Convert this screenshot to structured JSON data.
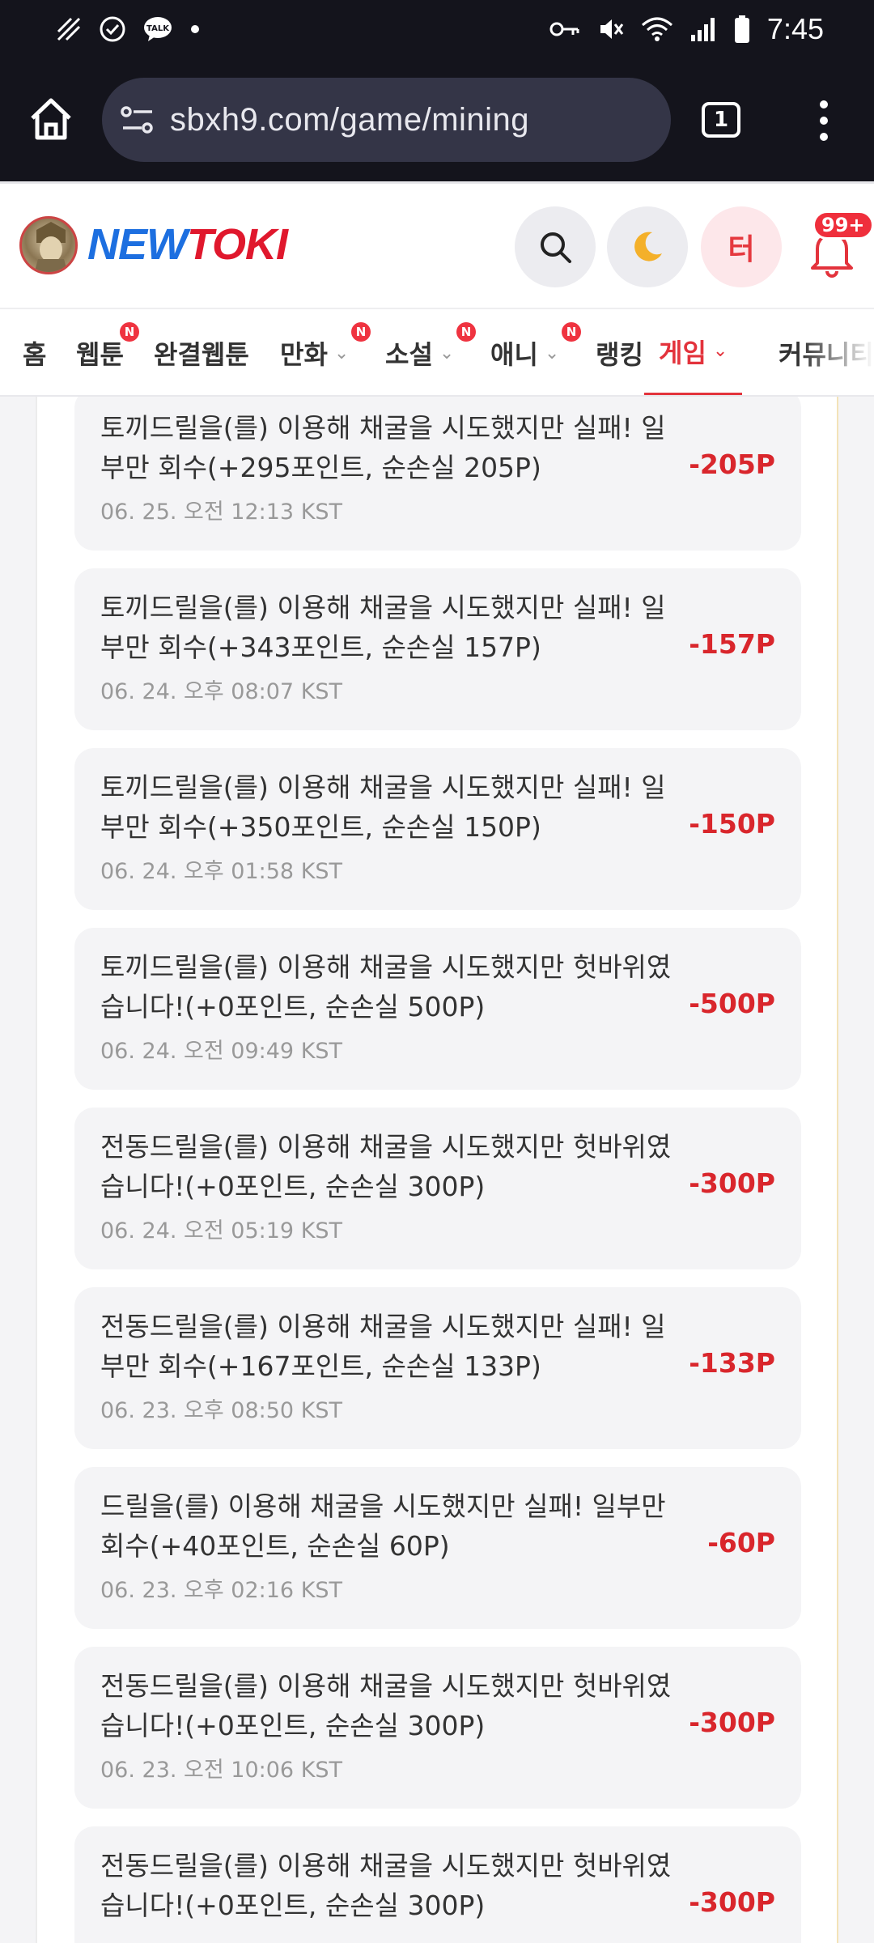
{
  "status_bar": {
    "time": "7:45",
    "left_icons": [
      "notification-icon",
      "check-circle-icon",
      "talk-icon",
      "dot-icon"
    ],
    "right_icons": [
      "key-icon",
      "mute-icon",
      "wifi-icon",
      "signal-icon",
      "battery-icon"
    ],
    "talk_label": "TALK"
  },
  "browser": {
    "url": "sbxh9.com/game/mining",
    "tab_count": "1"
  },
  "site": {
    "logo_new": "NEW",
    "logo_toki": "TOKI",
    "user_initial": "터",
    "notification_count": "99+"
  },
  "nav": {
    "items": [
      {
        "label": "홈",
        "badge": "",
        "chevron": false,
        "active": false
      },
      {
        "label": "웹툰",
        "badge": "N",
        "chevron": false,
        "active": false
      },
      {
        "label": "완결웹툰",
        "badge": "",
        "chevron": false,
        "active": false
      },
      {
        "label": "만화",
        "badge": "N",
        "chevron": true,
        "active": false
      },
      {
        "label": "소설",
        "badge": "N",
        "chevron": true,
        "active": false
      },
      {
        "label": "애니",
        "badge": "N",
        "chevron": true,
        "active": false
      },
      {
        "label": "랭킹",
        "badge": "",
        "chevron": false,
        "active": false
      },
      {
        "label": "게임",
        "badge": "",
        "chevron": true,
        "active": true
      },
      {
        "label": "커뮤니티",
        "badge": "",
        "chevron": false,
        "active": false
      }
    ]
  },
  "history": [
    {
      "message": "토끼드릴을(를) 이용해 채굴을 시도했지만 실패! 일부만 회수(+295포인트, 순손실 205P)",
      "time": "06. 25. 오전 12:13 KST",
      "amount": "-205P"
    },
    {
      "message": "토끼드릴을(를) 이용해 채굴을 시도했지만 실패! 일부만 회수(+343포인트, 순손실 157P)",
      "time": "06. 24. 오후 08:07 KST",
      "amount": "-157P"
    },
    {
      "message": "토끼드릴을(를) 이용해 채굴을 시도했지만 실패! 일부만 회수(+350포인트, 순손실 150P)",
      "time": "06. 24. 오후 01:58 KST",
      "amount": "-150P"
    },
    {
      "message": "토끼드릴을(를) 이용해 채굴을 시도했지만 헛바위였습니다!(+0포인트, 순손실 500P)",
      "time": "06. 24. 오전 09:49 KST",
      "amount": "-500P"
    },
    {
      "message": "전동드릴을(를) 이용해 채굴을 시도했지만 헛바위였습니다!(+0포인트, 순손실 300P)",
      "time": "06. 24. 오전 05:19 KST",
      "amount": "-300P"
    },
    {
      "message": "전동드릴을(를) 이용해 채굴을 시도했지만 실패! 일부만 회수(+167포인트, 순손실 133P)",
      "time": "06. 23. 오후 08:50 KST",
      "amount": "-133P"
    },
    {
      "message": "드릴을(를) 이용해 채굴을 시도했지만 실패! 일부만 회수(+40포인트, 순손실 60P)",
      "time": "06. 23. 오후 02:16 KST",
      "amount": "-60P"
    },
    {
      "message": "전동드릴을(를) 이용해 채굴을 시도했지만 헛바위였습니다!(+0포인트, 순손실 300P)",
      "time": "06. 23. 오전 10:06 KST",
      "amount": "-300P"
    },
    {
      "message": "전동드릴을(를) 이용해 채굴을 시도했지만 헛바위였습니다!(+0포인트, 순손실 300P)",
      "time": "",
      "amount": "-300P"
    }
  ],
  "colors": {
    "accent": "#e3333c",
    "amount": "#d9262c",
    "logo_blue": "#1d6fe0",
    "logo_red": "#e0182d"
  }
}
